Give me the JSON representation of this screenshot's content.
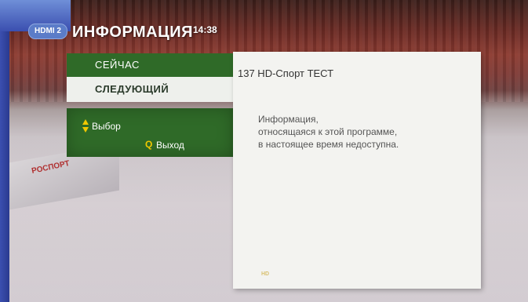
{
  "header": {
    "source_badge": "HDMI 2",
    "title": "ИНФОРМАЦИЯ",
    "time": "14:38"
  },
  "menu": {
    "items": [
      {
        "label": "СЕЙЧАС",
        "selected": false
      },
      {
        "label": "СЛЕДУЮЩИЙ",
        "selected": true
      }
    ]
  },
  "hints": {
    "select_label": "Выбор",
    "exit_key": "Q",
    "exit_label": "Выход"
  },
  "panel": {
    "channel": "137 HD-Спорт ТЕСТ",
    "message_lines": [
      "Информация,",
      "относящаяся к этой программе,",
      "в настоящее время недоступна."
    ],
    "hd_mark": "HD"
  },
  "background": {
    "banner_text": "РОСПОРТ"
  },
  "colors": {
    "menu_green": "#2f6a28",
    "panel_bg": "#f3f3f0",
    "accent_yellow": "#f0c800",
    "badge_blue": "#5b7cc8"
  }
}
